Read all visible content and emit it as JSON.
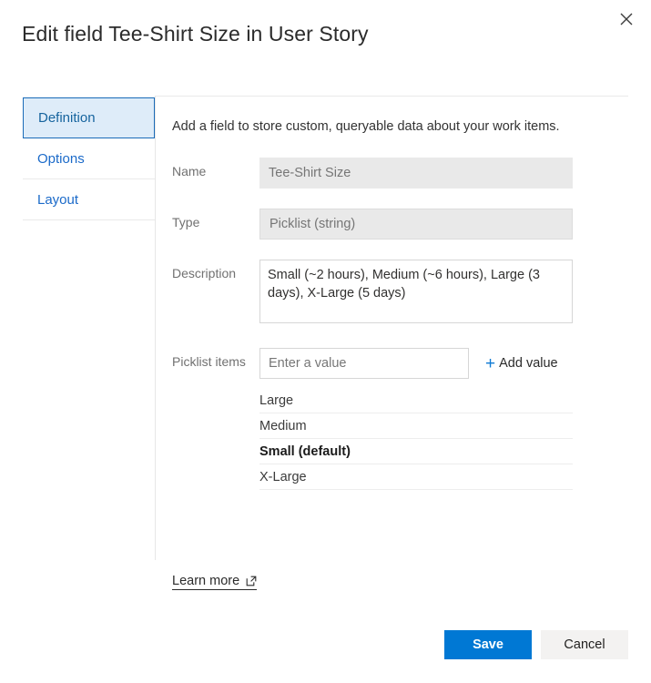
{
  "dialog": {
    "title": "Edit field Tee-Shirt Size in User Story",
    "close_label": "Close"
  },
  "tabs": [
    {
      "label": "Definition",
      "selected": true
    },
    {
      "label": "Options",
      "selected": false
    },
    {
      "label": "Layout",
      "selected": false
    }
  ],
  "definition": {
    "intro": "Add a field to store custom, queryable data about your work items.",
    "name": {
      "label": "Name",
      "value": "Tee-Shirt Size"
    },
    "type": {
      "label": "Type",
      "value": "Picklist (string)"
    },
    "description": {
      "label": "Description",
      "value": "Small (~2 hours), Medium (~6 hours), Large (3 days), X-Large (5 days)"
    },
    "picklist": {
      "label": "Picklist items",
      "input_placeholder": "Enter a value",
      "input_value": "",
      "add_value_label": "Add value",
      "items": [
        {
          "label": "Large",
          "default": false
        },
        {
          "label": "Medium",
          "default": false
        },
        {
          "label": "Small (default)",
          "default": true
        },
        {
          "label": "X-Large",
          "default": false
        }
      ]
    }
  },
  "learn_more": {
    "label": "Learn more"
  },
  "footer": {
    "save_label": "Save",
    "cancel_label": "Cancel"
  },
  "colors": {
    "primary": "#0078d4",
    "link": "#1b6ac9",
    "tab_selected_bg": "#deecf9",
    "tab_selected_border": "#1a6bb8",
    "disabled_field_bg": "#e9e9e9",
    "secondary_button_bg": "#f3f2f1"
  }
}
